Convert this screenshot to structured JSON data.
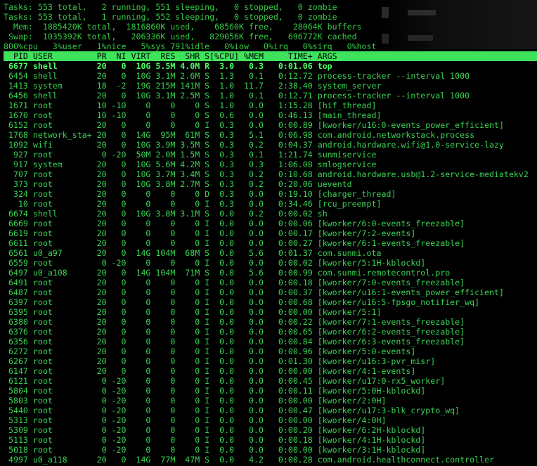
{
  "summary": {
    "line1": "Tasks: 553 total,   2 running, 551 sleeping,   0 stopped,   0 zombie",
    "line2": "Tasks: 553 total,   1 running, 552 sleeping,   0 stopped,   0 zombie",
    "line3": "  Mem:  1885420K total,  1816860K used,    68560K free,    28064K buffers",
    "line4": " Swap:  1035392K total,   206336K used,   829056K free,   696772K cached",
    "line5": "800%cpu   3%user   1%nice   5%sys 791%idle   0%iow   0%irq   0%sirq   0%host"
  },
  "header": "  PID USER         PR  NI VIRT  RES  SHR S[%CPU] %MEM     TIME+ ARGS",
  "rows": [
    " 6677 shell        20   0  10G 5.5M 4.0M R  3.0   0.3   0:01.06 top",
    " 6454 shell        20   0  10G 3.1M 2.6M S  1.3   0.1   0:12.72 process-tracker --interval 1000",
    " 1413 system       18  -2  19G 215M 141M S  1.0  11.7   2:38.40 system_server",
    " 6456 shell        20   0  10G 3.1M 2.5M S  1.0   0.1   0:12.71 process-tracker --interval 1000",
    " 1671 root         10 -10    0    0    0 S  1.0   0.0   1:15.28 [hif_thread]",
    " 1670 root         10 -10    0    0    0 S  0.6   0.0   0:46.13 [main_thread]",
    " 6152 root         20   0    0    0    0 I  0.3   0.0   0:00.89 [kworker/u16:0-events_power_efficient]",
    " 1768 network_sta+ 20   0  14G  95M  61M S  0.3   5.1   0:06.98 com.android.networkstack.process",
    " 1092 wifi         20   0  10G 3.9M 3.5M S  0.3   0.2   0:04.37 android.hardware.wifi@1.0-service-lazy",
    "  927 root          0 -20  50M 2.0M 1.5M S  0.3   0.1   1:21.74 sunmiservice",
    "  917 system       20   0  10G 5.6M 4.2M S  0.3   0.3   1:06.08 smlogservice",
    "  707 root         20   0  10G 3.7M 3.4M S  0.3   0.2   0:10.68 android.hardware.usb@1.2-service-mediatekv2",
    "  373 root         20   0  10G 3.8M 2.7M S  0.3   0.2   0:20.06 ueventd",
    "  324 root         20   0    0    0    0 D  0.3   0.0   0:19.10 [charger_thread]",
    "   10 root         20   0    0    0    0 I  0.3   0.0   0:34.46 [rcu_preempt]",
    " 6674 shell        20   0  10G 3.8M 3.1M S  0.0   0.2   0:00.02 sh",
    " 6669 root         20   0    0    0    0 I  0.0   0.0   0:00.06 [kworker/6:0-events_freezable]",
    " 6619 root         20   0    0    0    0 I  0.0   0.0   0:00.17 [kworker/7:2-events]",
    " 6611 root         20   0    0    0    0 I  0.0   0.0   0:00.27 [kworker/6:1-events_freezable]",
    " 6561 u0_a97       20   0  14G 104M  68M S  0.0   5.6   0:01.37 com.sunmi.ota",
    " 6559 root          0 -20    0    0    0 I  0.0   0.0   0:00.02 [kworker/5:1H-kblockd]",
    " 6497 u0_a108      20   0  14G 104M  71M S  0.0   5.6   0:00.99 com.sunmi.remotecontrol.pro",
    " 6491 root         20   0    0    0    0 I  0.0   0.0   0:00.18 [kworker/7:0-events_freezable]",
    " 6487 root         20   0    0    0    0 I  0.0   0.0   0:00.37 [kworker/u16:1-events_power_efficient]",
    " 6397 root         20   0    0    0    0 I  0.0   0.0   0:00.68 [kworker/u16:5-fpsgo_notifier_wq]",
    " 6395 root         20   0    0    0    0 I  0.0   0.0   0:00.00 [kworker/5:1]",
    " 6380 root         20   0    0    0    0 I  0.0   0.0   0:00.22 [kworker/7:1-events_freezable]",
    " 6376 root         20   0    0    0    0 I  0.0   0.0   0:00.65 [kworker/6:2-events_freezable]",
    " 6356 root         20   0    0    0    0 I  0.0   0.0   0:00.84 [kworker/6:3-events_freezable]",
    " 6272 root         20   0    0    0    0 I  0.0   0.0   0:00.96 [kworker/5:0-events]",
    " 6267 root         20   0    0    0    0 I  0.0   0.0   0:01.30 [kworker/u16:3-pvr_misr]",
    " 6147 root         20   0    0    0    0 I  0.0   0.0   0:00.00 [kworker/4:1-events]",
    " 6121 root          0 -20    0    0    0 I  0.0   0.0   0:00.45 [kworker/u17:0-rx5_worker]",
    " 5804 root          0 -20    0    0    0 I  0.0   0.0   0:00.11 [kworker/5:0H-kblockd]",
    " 5803 root          0 -20    0    0    0 I  0.0   0.0   0:00.00 [kworker/2:0H]",
    " 5440 root          0 -20    0    0    0 I  0.0   0.0   0:00.47 [kworker/u17:3-blk_crypto_wq]",
    " 5313 root          0 -20    0    0    0 I  0.0   0.0   0:00.00 [kworker/4:0H]",
    " 5309 root          0 -20    0    0    0 I  0.0   0.0   0:00.20 [kworker/6:2H-kblockd]",
    " 5113 root          0 -20    0    0    0 I  0.0   0.0   0:00.18 [kworker/4:1H-kblockd]",
    " 5018 root          0 -20    0    0    0 I  0.0   0.0   0:00.00 [kworker/3:1H-kblockd]",
    " 4997 u0_a118      20   0  14G  77M  47M S  0.0   4.2   0:00.28 com.android.healthconnect.controller"
  ]
}
